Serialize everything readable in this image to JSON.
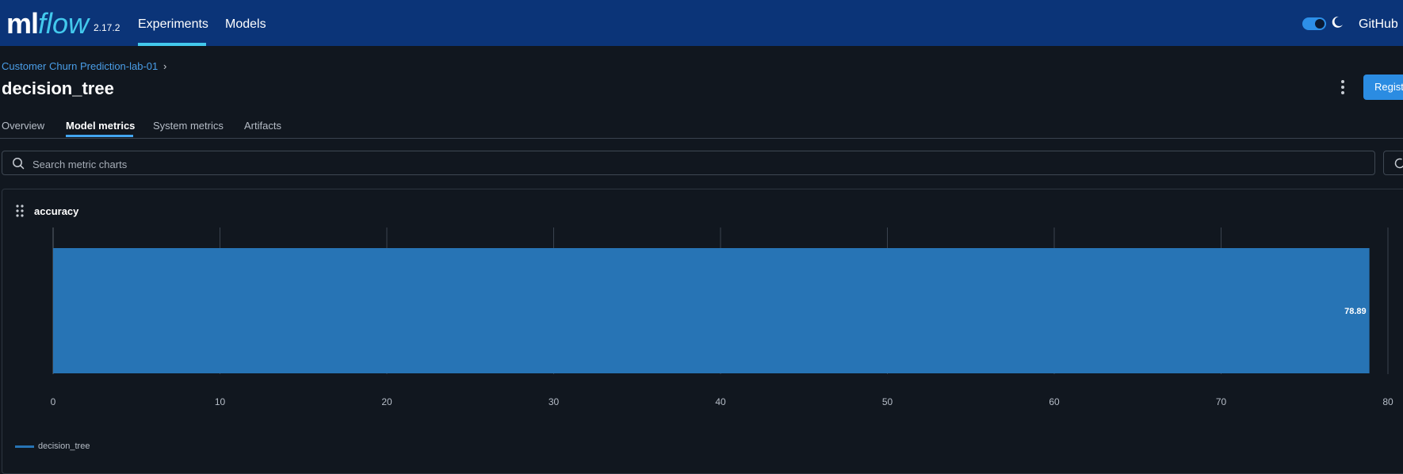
{
  "app": {
    "logo_ml": "ml",
    "logo_flow": "flow",
    "version": "2.17.2"
  },
  "nav": {
    "experiments": "Experiments",
    "models": "Models",
    "github": "GitHub"
  },
  "header": {
    "breadcrumb": "Customer Churn Prediction-lab-01",
    "breadcrumb_separator": "›",
    "title": "decision_tree",
    "register_button": "Register model"
  },
  "tabs": [
    {
      "label": "Overview",
      "active": false
    },
    {
      "label": "Model metrics",
      "active": true
    },
    {
      "label": "System metrics",
      "active": false
    },
    {
      "label": "Artifacts",
      "active": false
    }
  ],
  "search": {
    "placeholder": "Search metric charts"
  },
  "colors": {
    "topbar": "#0b3478",
    "accent": "#43c9ed",
    "bar": "#2774b5",
    "background": "#11171f"
  },
  "icons": {
    "search": "search-icon",
    "refresh": "refresh-icon",
    "drag": "drag-handle-icon",
    "theme": "moon-icon",
    "menu": "kebab-menu-icon"
  },
  "chart_data": {
    "type": "bar",
    "orientation": "horizontal",
    "title": "accuracy",
    "categories": [
      "decision_tree"
    ],
    "series": [
      {
        "name": "decision_tree",
        "values": [
          78.89
        ]
      }
    ],
    "data_labels": [
      "78.89"
    ],
    "xlim": [
      0,
      80
    ],
    "xticks": [
      0,
      10,
      20,
      30,
      40,
      50,
      60,
      70,
      80
    ],
    "grid": true,
    "legend": "bottom-left"
  }
}
